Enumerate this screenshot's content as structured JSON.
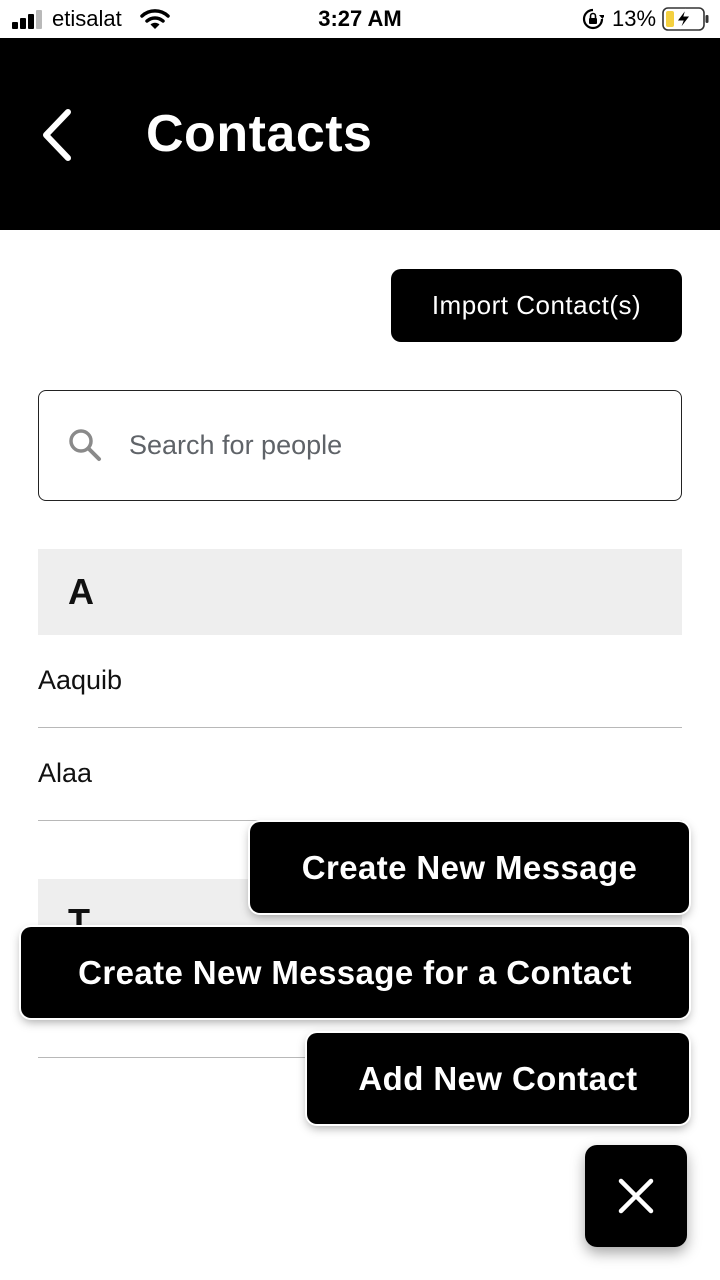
{
  "status_bar": {
    "carrier": "etisalat",
    "time": "3:27 AM",
    "battery_percent": "13%",
    "icons": [
      "signal-icon",
      "wifi-icon",
      "rotation-lock-icon",
      "battery-charging-icon"
    ]
  },
  "header": {
    "title": "Contacts",
    "back_icon": "chevron-left-icon"
  },
  "actions": {
    "import_label": "Import Contact(s)"
  },
  "search": {
    "placeholder": "Search for people",
    "value": "",
    "icon": "search-icon"
  },
  "sections": [
    {
      "letter": "A",
      "contacts": [
        {
          "name": "Aaquib"
        },
        {
          "name": "Alaa"
        }
      ]
    },
    {
      "letter": "T",
      "contacts": [
        {
          "name": ""
        }
      ]
    }
  ],
  "fab_menu": {
    "options": [
      {
        "label": "Create New Message"
      },
      {
        "label": "Create New Message for a Contact"
      },
      {
        "label": "Add New Contact"
      }
    ],
    "close_icon": "close-icon"
  },
  "colors": {
    "primary": "#000000",
    "on_primary": "#ffffff",
    "section_bg": "#eeeeee",
    "divider": "#b8b8b8"
  }
}
